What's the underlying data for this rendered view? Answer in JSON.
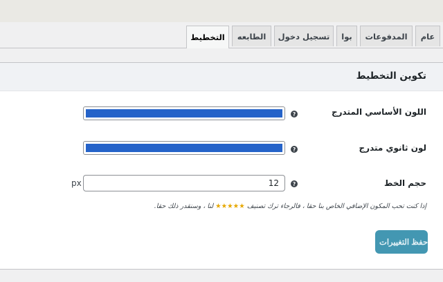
{
  "tabs": [
    {
      "label": "عام"
    },
    {
      "label": "المدفوعات"
    },
    {
      "label": "بوا"
    },
    {
      "label": "تسجيل دخول"
    },
    {
      "label": "الطابعه"
    },
    {
      "label": "التخطيط"
    }
  ],
  "section": {
    "title": "تكوين التخطيط"
  },
  "fields": {
    "primary": {
      "label": "اللون الأساسي المتدرج",
      "color": "#2563c9"
    },
    "secondary": {
      "label": "لون ثانوي متدرج",
      "color": "#2563c9"
    },
    "font_size": {
      "label": "حجم الخط",
      "value": "12",
      "unit": "px"
    }
  },
  "help_glyph": "?",
  "note": {
    "before": "إذا كنت تحب المكون الإضافي الخاص بنا حقا ، فالرجاء ترك تصنيف",
    "stars": "★★★★★",
    "after": "لنا ، وسنقدر ذلك حقا."
  },
  "save_label": "حفظ التغييرات"
}
